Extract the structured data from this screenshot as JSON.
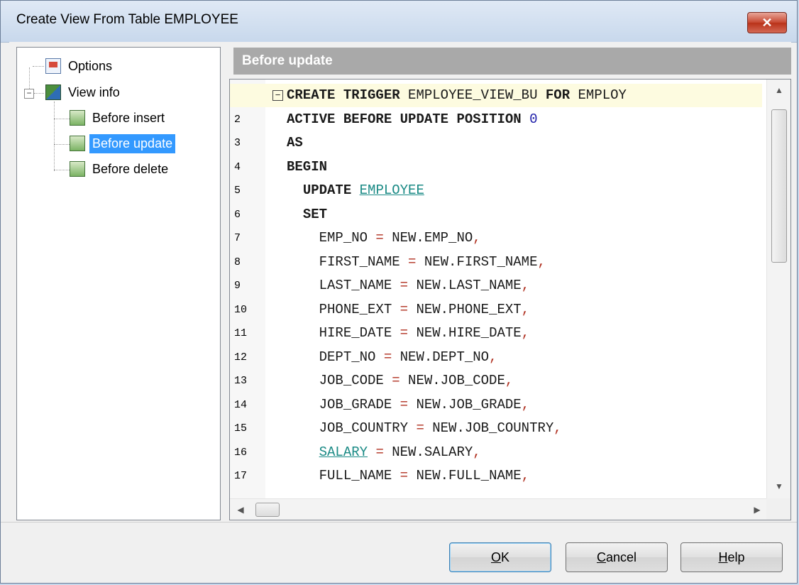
{
  "window": {
    "title": "Create View From Table EMPLOYEE",
    "close_glyph": "✕"
  },
  "tree": {
    "expander": "−",
    "items": [
      {
        "label": "Options",
        "icon": "options-icon"
      },
      {
        "label": "View info",
        "icon": "view-info-icon"
      },
      {
        "label": "Before insert",
        "icon": "trigger-icon"
      },
      {
        "label": "Before update",
        "icon": "trigger-icon",
        "selected": true
      },
      {
        "label": "Before delete",
        "icon": "trigger-icon"
      }
    ]
  },
  "section": {
    "title": "Before update"
  },
  "editor": {
    "fold_glyph": "−",
    "line_numbers": [
      "",
      "2",
      "3",
      "4",
      "5",
      "6",
      "7",
      "8",
      "9",
      "10",
      "11",
      "12",
      "13",
      "14",
      "15",
      "16",
      "17"
    ],
    "lines": [
      "CREATE TRIGGER EMPLOYEE_VIEW_BU FOR EMPLOY",
      "ACTIVE BEFORE UPDATE POSITION 0",
      "AS",
      "BEGIN",
      "  UPDATE EMPLOYEE",
      "  SET",
      "    EMP_NO = NEW.EMP_NO,",
      "    FIRST_NAME = NEW.FIRST_NAME,",
      "    LAST_NAME = NEW.LAST_NAME,",
      "    PHONE_EXT = NEW.PHONE_EXT,",
      "    HIRE_DATE = NEW.HIRE_DATE,",
      "    DEPT_NO = NEW.DEPT_NO,",
      "    JOB_CODE = NEW.JOB_CODE,",
      "    JOB_GRADE = NEW.JOB_GRADE,",
      "    JOB_COUNTRY = NEW.JOB_COUNTRY,",
      "    SALARY = NEW.SALARY,",
      "    FULL_NAME = NEW.FULL_NAME,"
    ]
  },
  "buttons": {
    "ok": {
      "mnemonic": "O",
      "rest": "K"
    },
    "cancel": {
      "mnemonic": "C",
      "rest": "ancel"
    },
    "help": {
      "mnemonic": "H",
      "rest": "elp"
    }
  },
  "colors": {
    "selection": "#3399ff",
    "keyword": "#1a1a1a",
    "object": "#1a8a85",
    "number": "#1c1ca8",
    "punct": "#b03020"
  }
}
